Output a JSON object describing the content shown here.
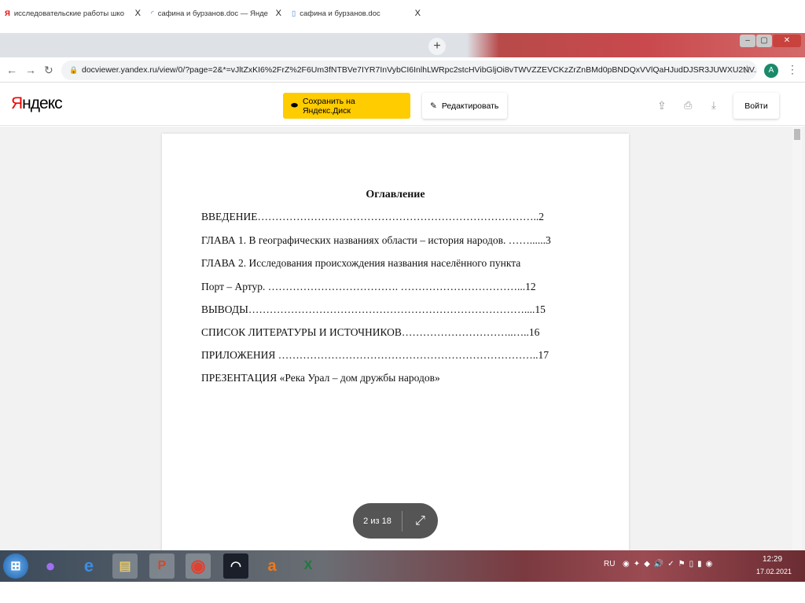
{
  "browser": {
    "tabs": [
      {
        "label": "исследовательские работы шко",
        "icon": "yandex-icon"
      },
      {
        "label": "сафина и бурзанов.doc — Янде",
        "icon": "yandex-disk-icon"
      },
      {
        "label": "сафина и бурзанов.doc",
        "icon": "document-icon",
        "active": true
      }
    ],
    "close_glyph": "X",
    "new_tab": "+",
    "url": "docviewer.yandex.ru/view/0/?page=2&*=vJltZxKI6%2FrZ%2F6Um3fNTBVe7IYR7InVybCI6InlhLWRpc2stcHVibGljOi8vTWVZZEVCKzZrZnBMd0pBNDQxVVlQaHJudDJSR3JUWXU2NV...",
    "profile_initial": "A"
  },
  "viewer": {
    "logo_first": "Я",
    "logo_rest": "ндекс",
    "save_button": "Сохранить на Яндекс.Диск",
    "edit_button": "Редактировать",
    "login_button": "Войти",
    "page_indicator": "2 из 18"
  },
  "document": {
    "title": "Оглавление",
    "lines": [
      "ВВЕДЕНИЕ……………………………………………………………………..2",
      "ГЛАВА 1. В географических названиях области – история народов. ……......3",
      "ГЛАВА  2. Исследования происхождения названия населённого пункта",
      "Порт – Артур. ………………………………. ……………………………...12",
      "ВЫВОДЫ……………………………………………………………………....15",
      "СПИСОК  ЛИТЕРАТУРЫ И ИСТОЧНИКОВ…………………………..…..16",
      "ПРИЛОЖЕНИЯ ………………………………………………………………..17",
      "ПРЕЗЕНТАЦИЯ  «Река Урал – дом дружбы народов»"
    ]
  },
  "taskbar": {
    "language": "RU",
    "time": "12:29",
    "date": "17.02.2021"
  }
}
